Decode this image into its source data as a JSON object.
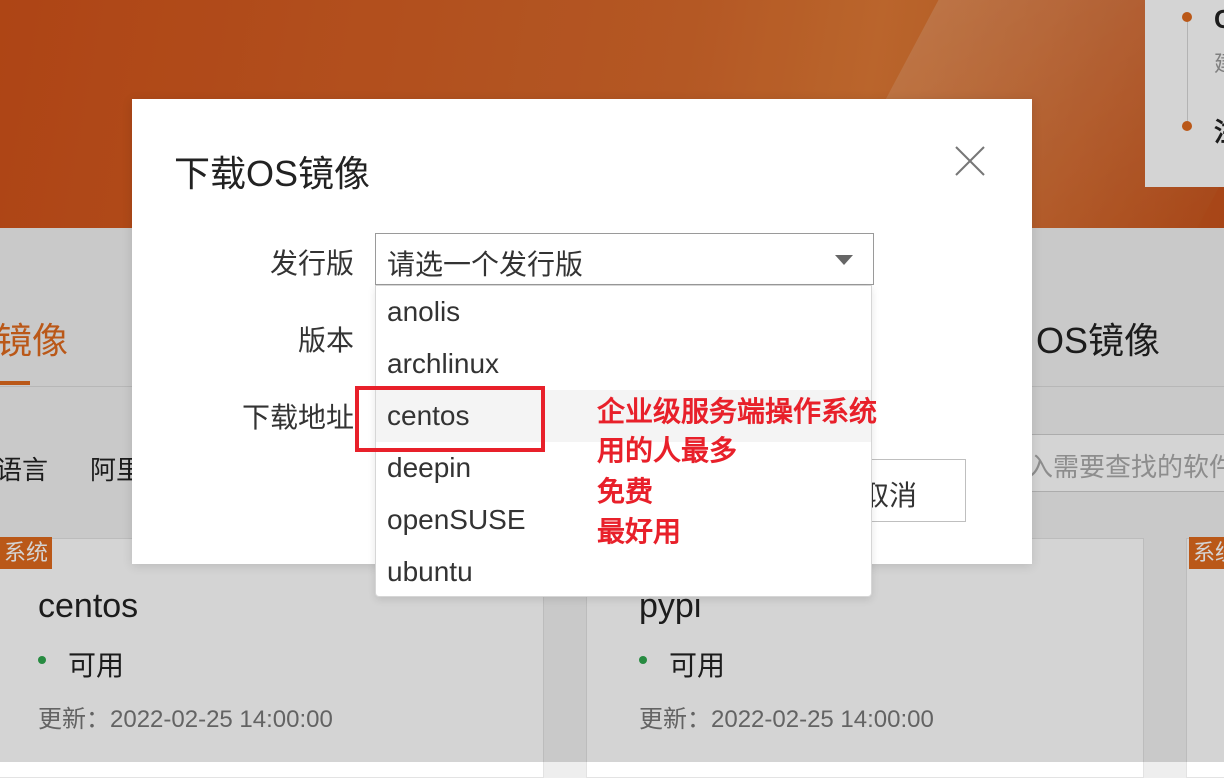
{
  "background": {
    "timeline": {
      "item1_title": "C",
      "item1_sub": "建",
      "item2_title": "注"
    },
    "section_title_left": "镜像",
    "section_title_right": "OS镜像",
    "filters": [
      "语言",
      "阿里"
    ],
    "search_placeholder": "入需要查找的软件",
    "cards": [
      {
        "tag": "系统",
        "name": "centos",
        "status": "可用",
        "updated": "更新：2022-02-25 14:00:00"
      },
      {
        "tag": "",
        "name": "pypi",
        "status": "可用",
        "updated": "更新：2022-02-25 14:00:00"
      },
      {
        "tag": "系统"
      }
    ]
  },
  "modal": {
    "title": "下载OS镜像",
    "close_icon": "close-icon",
    "distro_label": "发行版",
    "distro_placeholder": "请选一个发行版",
    "version_label": "版本",
    "download_label": "下载地址",
    "cancel_label": "取消"
  },
  "dropdown": {
    "options": [
      "anolis",
      "archlinux",
      "centos",
      "deepin",
      "openSUSE",
      "ubuntu"
    ],
    "highlighted": "centos"
  },
  "annotation": {
    "lines": [
      "企业级服务端操作系统",
      "用的人最多",
      "免费",
      "最好用"
    ],
    "color": "#e8202a"
  },
  "colors": {
    "accent": "#e06a1e",
    "status_ok": "#2fa84f"
  }
}
